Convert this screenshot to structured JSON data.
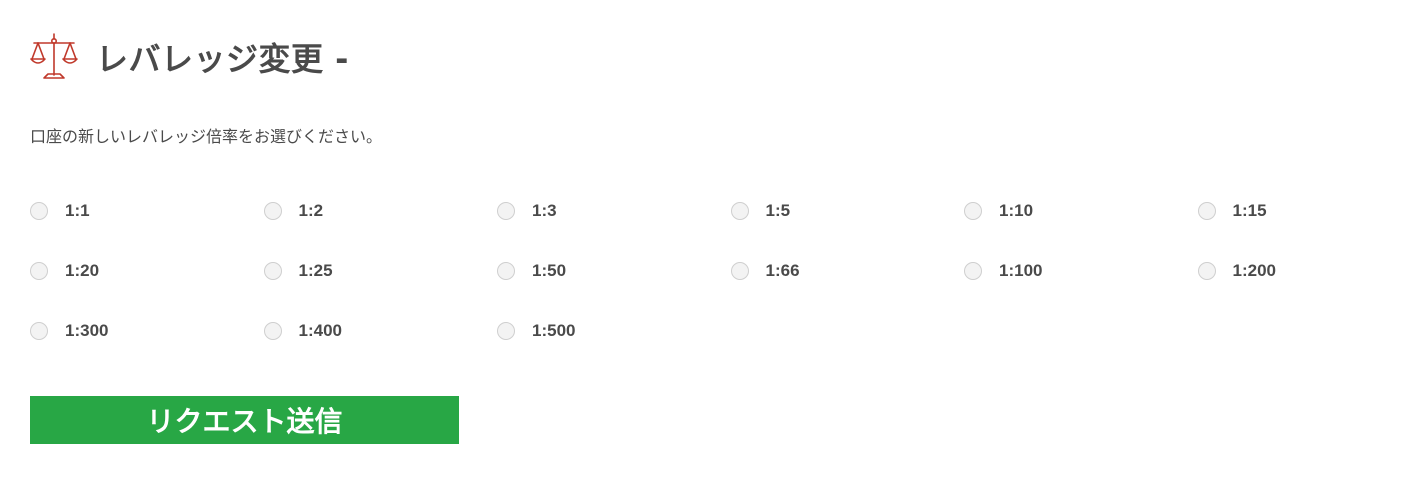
{
  "header": {
    "title": "レバレッジ変更 -",
    "icon": "scale-icon"
  },
  "instruction": "口座の新しいレバレッジ倍率をお選びください。",
  "leverage_options": [
    {
      "label": "1:1",
      "selected": false
    },
    {
      "label": "1:2",
      "selected": false
    },
    {
      "label": "1:3",
      "selected": false
    },
    {
      "label": "1:5",
      "selected": false
    },
    {
      "label": "1:10",
      "selected": false
    },
    {
      "label": "1:15",
      "selected": false
    },
    {
      "label": "1:20",
      "selected": false
    },
    {
      "label": "1:25",
      "selected": false
    },
    {
      "label": "1:50",
      "selected": false
    },
    {
      "label": "1:66",
      "selected": false
    },
    {
      "label": "1:100",
      "selected": false
    },
    {
      "label": "1:200",
      "selected": false
    },
    {
      "label": "1:300",
      "selected": false
    },
    {
      "label": "1:400",
      "selected": false
    },
    {
      "label": "1:500",
      "selected": false
    }
  ],
  "submit": {
    "label": "リクエスト送信"
  },
  "colors": {
    "accent_icon": "#c0392b",
    "button_bg": "#28a745",
    "button_text": "#ffffff",
    "text": "#4a4a4a"
  }
}
